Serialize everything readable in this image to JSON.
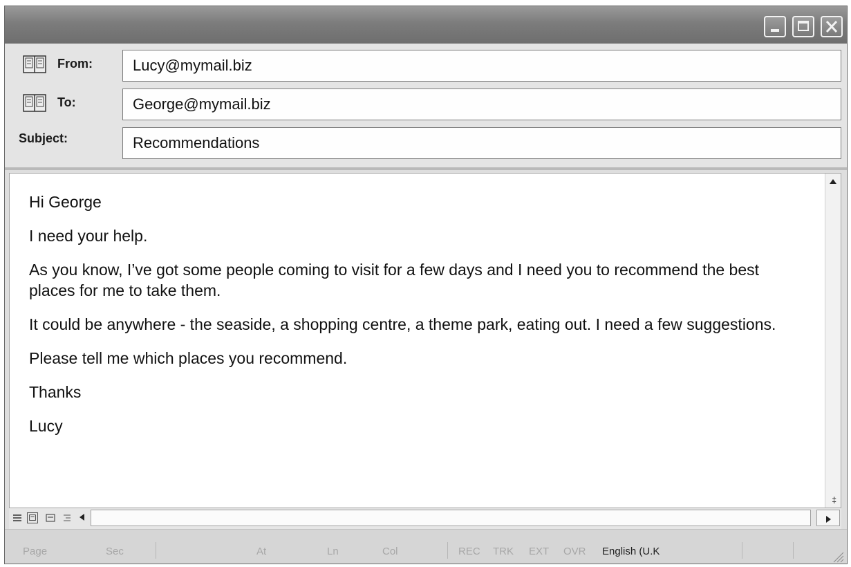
{
  "window": {
    "controls": {
      "minimize_icon": "minimize-icon",
      "maximize_icon": "maximize-icon",
      "close_icon": "close-icon"
    }
  },
  "header": {
    "from": {
      "label": "From:",
      "value": "Lucy@mymail.biz",
      "icon": "address-book-icon"
    },
    "to": {
      "label": "To:",
      "value": "George@mymail.biz",
      "icon": "address-book-icon"
    },
    "subject": {
      "label": "Subject:",
      "value": "Recommendations"
    }
  },
  "message": {
    "paragraphs": [
      "Hi George",
      "I need your help.",
      "As you know, I’ve got some people coming to visit for a few days and I need you to recommend the best places for me to take them.",
      "It could be anywhere - the seaside, a shopping centre, a theme park, eating out. I need a few suggestions.",
      "Please tell me which places you recommend.",
      "Thanks",
      "Lucy"
    ]
  },
  "status_bar": {
    "page": "Page",
    "sec": "Sec",
    "at": "At",
    "ln": "Ln",
    "col": "Col",
    "rec": "REC",
    "trk": "TRK",
    "ext": "EXT",
    "ovr": "OVR",
    "language": "English (U.K"
  },
  "colors": {
    "titlebar": "#7c7c7c",
    "header_bg": "#e4e4e4",
    "status_bg": "#d6d6d6",
    "dim_text": "#a7a7a7"
  }
}
